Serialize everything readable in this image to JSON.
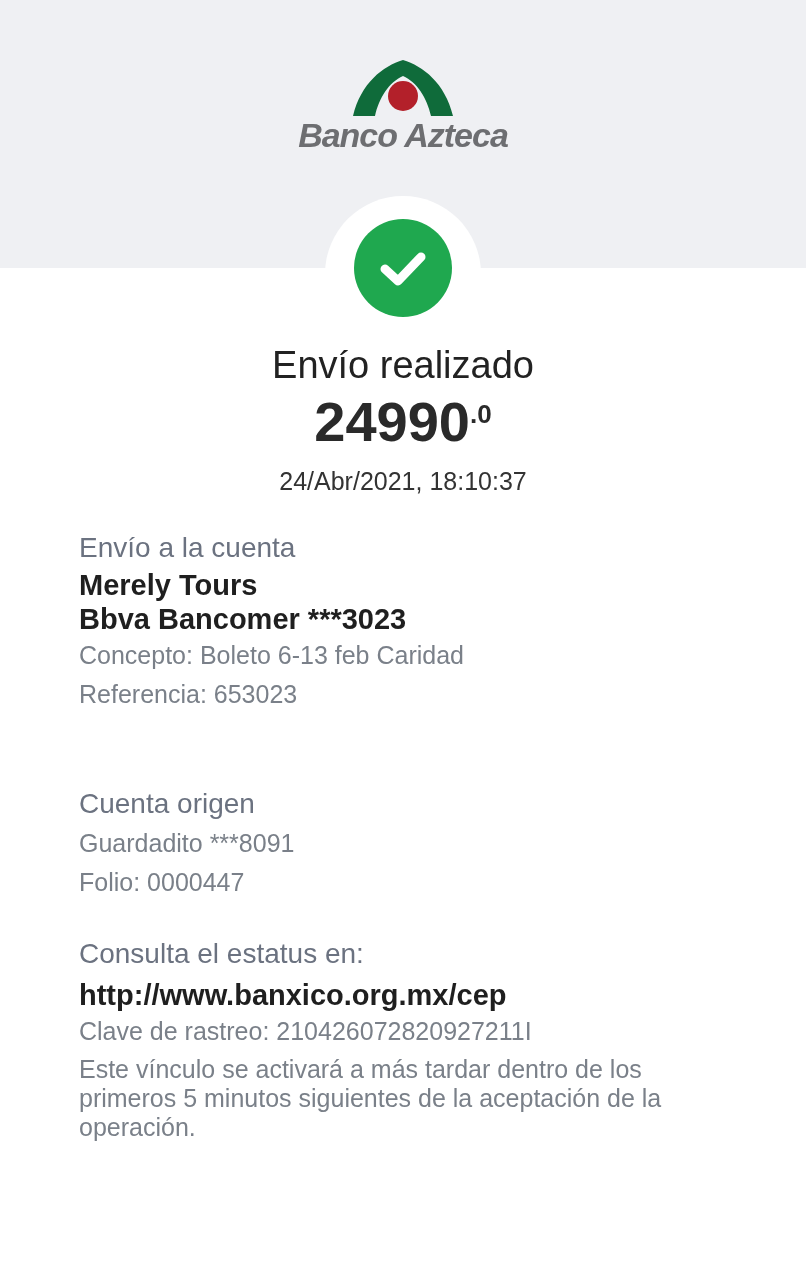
{
  "header": {
    "logo_text": "Banco Azteca"
  },
  "status": {
    "title": "Envío realizado",
    "amount": "24990$^{.0}$",
    "datetime": "24/Abr/2021, 18:10:37"
  },
  "destination": {
    "heading": "Envío a la cuenta",
    "name": "Merely Tours",
    "account": "Bbva Bancomer ***3023",
    "concept": "Concepto: Boleto 6-13 feb Caridad",
    "reference": "Referencia: 653023"
  },
  "origin": {
    "heading": "Cuenta origen",
    "account": "Guardadito  ***8091",
    "folio": "Folio: 0000447"
  },
  "tracking": {
    "heading": "Consulta el estatus en:",
    "url": "http://www.banxico.org.mx/cep",
    "key": "Clave de rastreo: 210426072820927211I",
    "note": "Este vínculo se activará a más tardar dentro de los primeros 5 minutos siguientes de la aceptación de la operación."
  }
}
